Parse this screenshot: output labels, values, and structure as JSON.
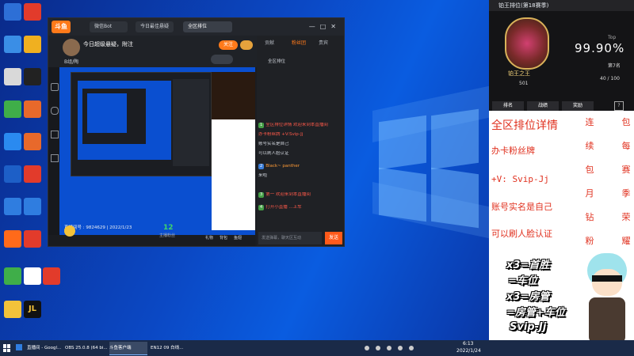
{
  "colors": {
    "desktop": "#0b48c4",
    "app_bg": "#1b1d22",
    "accent": "#ff7a1a",
    "promo_text": "#e0311f",
    "rank_gold": "#d9b25a"
  },
  "desktop_icons": [
    "Windows",
    "",
    "",
    "",
    "",
    "",
    "",
    "",
    "",
    "",
    "",
    "",
    "",
    "",
    "",
    "",
    "",
    "",
    "",
    "",
    "",
    "",
    "",
    ""
  ],
  "app": {
    "logo": "斗鱼",
    "tabs": [
      "微信Bot",
      "今日最佳悬疑",
      "全区排位",
      "?"
    ],
    "room_title": "今日超级悬疑，附注",
    "streamer": "B组/陶",
    "follow_label": "关注",
    "right_tabs": [
      "贡献",
      "粉丝团",
      "贵宾"
    ],
    "chat_badge": "全区排位",
    "chat_lines": [
      "全区排位详情 欢迎来到本直播间",
      "办卡粉丝牌 +V:Svip-Jj",
      "账号实名是自己",
      "可以刷人脸认证",
      "Black~ panther",
      "来啦",
      "第一 欢迎来到本直播间",
      "打开小直播 ...上车"
    ],
    "stream_caption": "直播间号 : 9824629 | 2022/1/23",
    "bottom_count": "12",
    "bottom_label": "主播粉丝",
    "gift_labels": [
      "礼物",
      "背包",
      "鱼翅"
    ],
    "send_label": "发送",
    "chat_placeholder": "发送弹幕，聊天区互动"
  },
  "rank_panel": {
    "title": "铂王排位(第18赛季)",
    "top_label": "Top",
    "percent": "99.90%",
    "rank_name": "铂王之王",
    "rank_sub": "第7名",
    "score": "501",
    "progress": "40 / 100",
    "buttons": [
      "排名",
      "战绩",
      "奖励"
    ]
  },
  "promo": {
    "line1": "全区排位详情",
    "line2": "办卡粉丝牌",
    "line3": "+V: Svip-Jj",
    "line4": "账号实名是自己",
    "line5": "可以刷人脸认证",
    "col1": [
      "连",
      "续",
      "包",
      "月",
      "钻",
      "粉"
    ],
    "col2": [
      "包",
      "每",
      "赛",
      "季",
      "荣",
      "耀"
    ],
    "stickers": [
      "x3=首胜",
      "=车位",
      "x3=房管",
      "=房管+车位",
      "Svip-Jj"
    ]
  },
  "taskbar": {
    "items": [
      "直播间 - Googl...",
      "OBS 25.0.8 (64 bi...",
      "斗鱼客户端",
      "EN12 09 白线..."
    ],
    "time": "6:13",
    "date": "2022/1/24"
  }
}
